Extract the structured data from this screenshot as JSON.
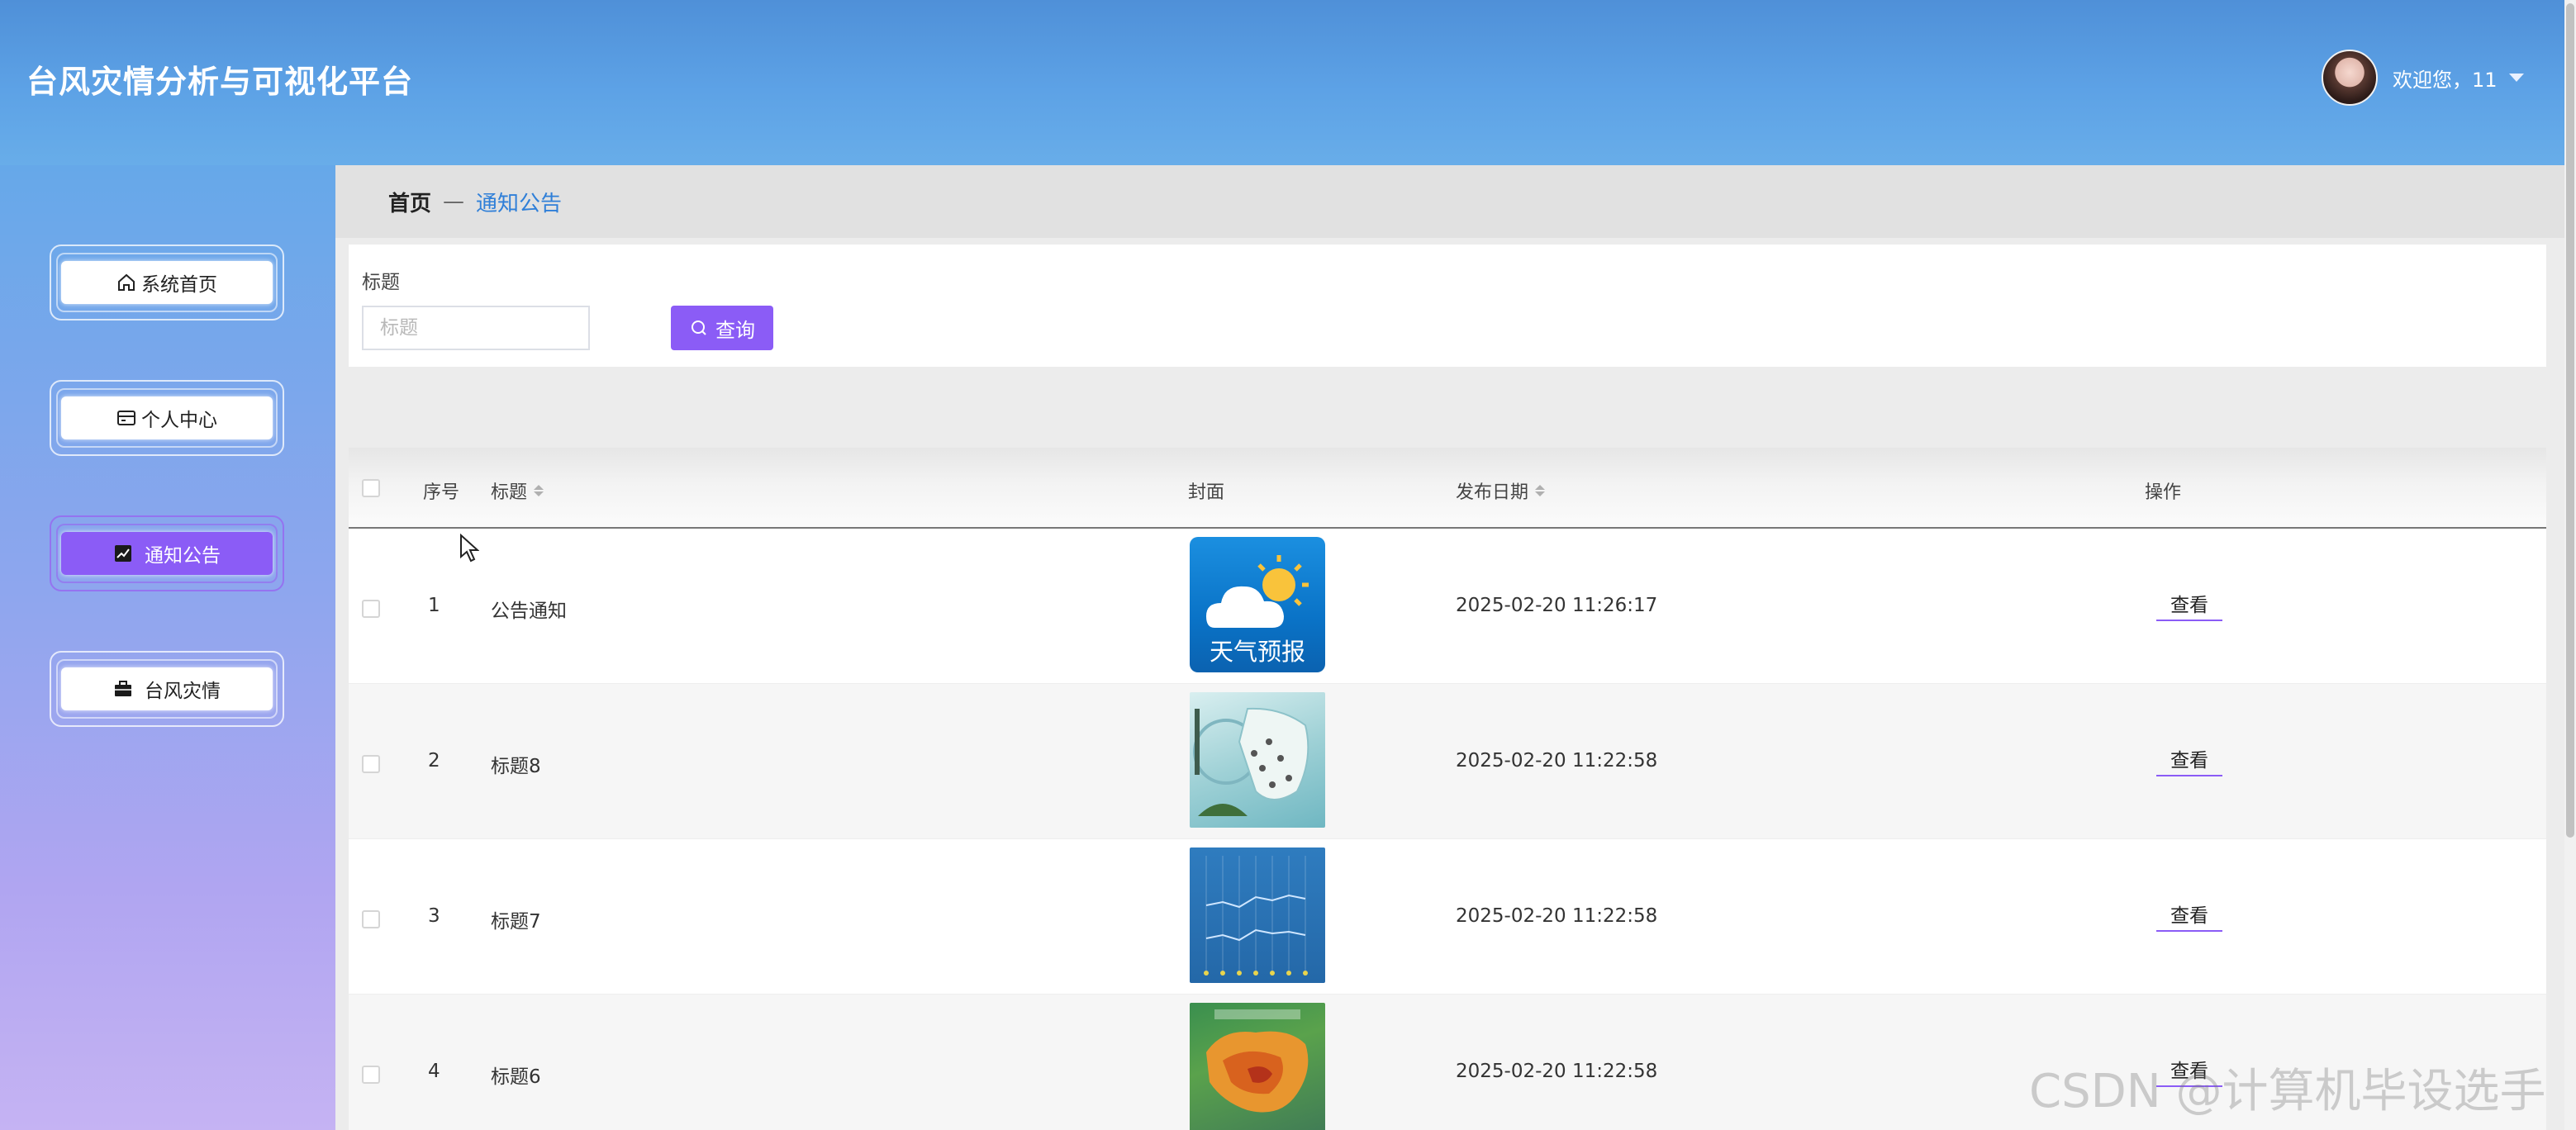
{
  "header": {
    "app_title": "台风灾情分析与可视化平台",
    "welcome": "欢迎您，11"
  },
  "sidebar": {
    "items": [
      {
        "label": "系统首页",
        "icon": "home-icon"
      },
      {
        "label": "个人中心",
        "icon": "user-card-icon"
      },
      {
        "label": "通知公告",
        "icon": "chart-icon",
        "active": true
      },
      {
        "label": "台风灾情",
        "icon": "briefcase-icon"
      }
    ]
  },
  "breadcrumb": {
    "home": "首页",
    "separator": "—",
    "current": "通知公告"
  },
  "search": {
    "label": "标题",
    "placeholder": "标题",
    "button_label": "查询"
  },
  "table": {
    "headers": {
      "index": "序号",
      "title": "标题",
      "cover": "封面",
      "date": "发布日期",
      "action": "操作"
    },
    "rows": [
      {
        "index": "1",
        "title": "公告通知",
        "cover_text": "天气预报",
        "date": "2025-02-20 11:26:17",
        "action": "查看"
      },
      {
        "index": "2",
        "title": "标题8",
        "cover_text": "",
        "date": "2025-02-20 11:22:58",
        "action": "查看"
      },
      {
        "index": "3",
        "title": "标题7",
        "cover_text": "",
        "date": "2025-02-20 11:22:58",
        "action": "查看"
      },
      {
        "index": "4",
        "title": "标题6",
        "cover_text": "",
        "date": "2025-02-20 11:22:58",
        "action": "查看"
      }
    ]
  },
  "watermark": "CSDN @计算机毕设选手",
  "colors": {
    "accent": "#8b5cf6",
    "header_blue": "#5da2e6",
    "link_blue": "#2f7fd8"
  }
}
